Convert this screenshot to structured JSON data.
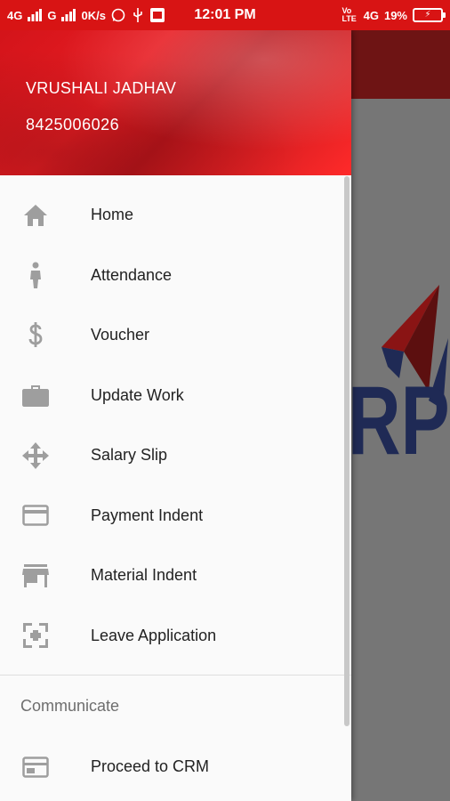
{
  "status_bar": {
    "left": [
      "4G",
      "G",
      "0K/s"
    ],
    "time": "12:01 PM",
    "right": [
      "4G",
      "19%"
    ]
  },
  "drawer": {
    "user_name": "VRUSHALI JADHAV",
    "user_phone": "8425006026",
    "items": [
      {
        "label": "Home",
        "icon": "home-icon"
      },
      {
        "label": "Attendance",
        "icon": "person-icon"
      },
      {
        "label": "Voucher",
        "icon": "dollar-icon"
      },
      {
        "label": "Update Work",
        "icon": "briefcase-icon"
      },
      {
        "label": "Salary Slip",
        "icon": "move-arrows-icon"
      },
      {
        "label": "Payment Indent",
        "icon": "credit-card-icon"
      },
      {
        "label": "Material Indent",
        "icon": "store-icon"
      },
      {
        "label": "Leave Application",
        "icon": "crop-frame-icon"
      }
    ],
    "section_title": "Communicate",
    "communicate_items": [
      {
        "label": "Proceed to CRM",
        "icon": "window-icon"
      }
    ]
  },
  "colors": {
    "status_bar": "#d81414",
    "header_red": "#e71c22",
    "icon_gray": "#9e9e9e",
    "scrim": "#6b6b6b"
  }
}
